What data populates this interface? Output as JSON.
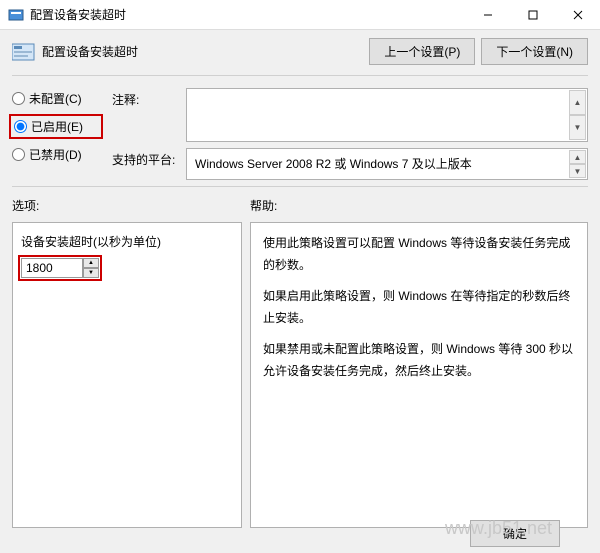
{
  "window": {
    "title": "配置设备安装超时"
  },
  "header": {
    "title": "配置设备安装超时"
  },
  "nav": {
    "prev": "上一个设置(P)",
    "next": "下一个设置(N)"
  },
  "radios": {
    "not_configured": "未配置(C)",
    "enabled": "已启用(E)",
    "disabled": "已禁用(D)"
  },
  "fields": {
    "comment_label": "注释:",
    "platform_label": "支持的平台:",
    "platform_value": "Windows Server 2008 R2 或 Windows 7 及以上版本"
  },
  "labels": {
    "options": "选项:",
    "help": "帮助:"
  },
  "options": {
    "timeout_label": "设备安装超时(以秒为单位)",
    "timeout_value": "1800"
  },
  "help": {
    "p1": "使用此策略设置可以配置 Windows 等待设备安装任务完成的秒数。",
    "p2": "如果启用此策略设置，则 Windows 在等待指定的秒数后终止安装。",
    "p3": "如果禁用或未配置此策略设置，则 Windows 等待 300 秒以允许设备安装任务完成，然后终止安装。"
  },
  "footer": {
    "ok": "确定"
  },
  "watermark": "www.jb51.net"
}
